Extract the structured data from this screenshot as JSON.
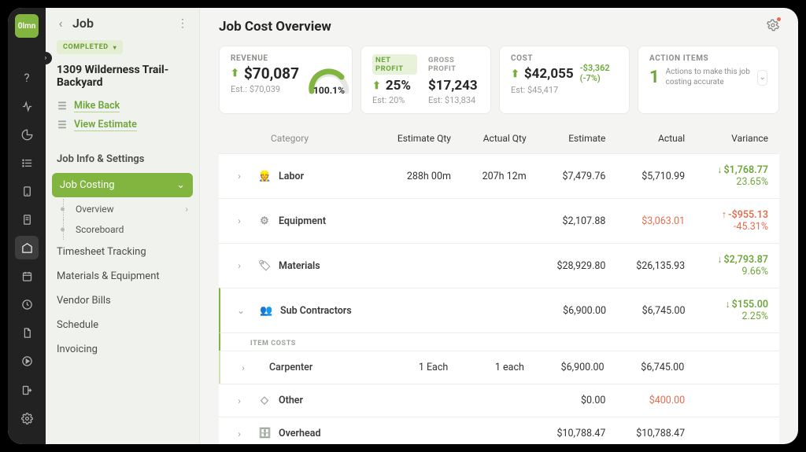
{
  "brand": {
    "short": "0lmn"
  },
  "rail": {
    "help": "help",
    "activity": "activity",
    "metrics": "metrics",
    "reports": "reports",
    "list": "list",
    "tablet": "tablet",
    "file": "file",
    "costing": "costing",
    "calendar": "calendar",
    "time": "time",
    "doc": "doc",
    "play": "play",
    "exit": "exit",
    "settings": "settings"
  },
  "jobHeader": {
    "kind": "Job"
  },
  "status": {
    "label": "COMPLETED"
  },
  "jobTitle": "1309 Wilderness Trail-Backyard",
  "jobMeta": {
    "contact": "Mike Back",
    "estimate": "View Estimate"
  },
  "sidebar": {
    "jobInfo": "Job Info & Settings",
    "jobCosting": "Job Costing",
    "overview": "Overview",
    "scoreboard": "Scoreboard",
    "timesheet": "Timesheet Tracking",
    "materials": "Materials & Equipment",
    "vendor": "Vendor Bills",
    "schedule": "Schedule",
    "invoicing": "Invoicing"
  },
  "page": {
    "title": "Job Cost Overview"
  },
  "metrics": {
    "revenue": {
      "label": "REVENUE",
      "value": "$70,087",
      "estLabel": "Est.:",
      "est": "$70,039",
      "gauge": "100.1%",
      "gaugePct": 100.1
    },
    "profit": {
      "netTab": "NET PROFIT",
      "grossTab": "GROSS PROFIT",
      "netValue": "25%",
      "netEstLabel": "Est:",
      "netEst": "20%",
      "grossValue": "$17,243",
      "grossEstLabel": "Est:",
      "grossEst": "$13,834"
    },
    "cost": {
      "label": "COST",
      "value": "$42,055",
      "delta": "-$3,362 (-7%)",
      "estLabel": "Est:",
      "est": "$45,417"
    },
    "actions": {
      "label": "ACTION ITEMS",
      "count": "1",
      "text": "Actions to make this job costing accurate"
    }
  },
  "table": {
    "headers": {
      "category": "Category",
      "estQty": "Estimate Qty",
      "actQty": "Actual Qty",
      "estimate": "Estimate",
      "actual": "Actual",
      "variance": "Variance"
    },
    "itemCostsLabel": "ITEM COSTS",
    "rows": {
      "labor": {
        "name": "Labor",
        "estQty": "288h 00m",
        "actQty": "207h 12m",
        "estimate": "$7,479.76",
        "actual": "$5,710.99",
        "varAmount": "$1,768.77",
        "varPct": "23.65%",
        "dir": "pos"
      },
      "equipment": {
        "name": "Equipment",
        "estQty": "",
        "actQty": "",
        "estimate": "$2,107.88",
        "actual": "$3,063.01",
        "varAmount": "-$955.13",
        "varPct": "-45.31%",
        "dir": "neg"
      },
      "materials": {
        "name": "Materials",
        "estQty": "",
        "actQty": "",
        "estimate": "$28,929.80",
        "actual": "$26,135.93",
        "varAmount": "$2,793.87",
        "varPct": "9.66%",
        "dir": "pos"
      },
      "subcontractors": {
        "name": "Sub Contractors",
        "estQty": "",
        "actQty": "",
        "estimate": "$6,900.00",
        "actual": "$6,745.00",
        "varAmount": "$155.00",
        "varPct": "2.25%",
        "dir": "pos"
      },
      "carpenter": {
        "name": "Carpenter",
        "estQty": "1 Each",
        "actQty": "1 each",
        "estimate": "$6,900.00",
        "actual": "$6,745.00"
      },
      "other": {
        "name": "Other",
        "estQty": "",
        "actQty": "",
        "estimate": "$0.00",
        "actual": "$400.00",
        "varAmount": "",
        "varPct": "",
        "dir": "neg"
      },
      "overhead": {
        "name": "Overhead",
        "estQty": "",
        "actQty": "",
        "estimate": "$10,788.47",
        "actual": "$10,788.47",
        "varAmount": "",
        "varPct": ""
      }
    }
  }
}
